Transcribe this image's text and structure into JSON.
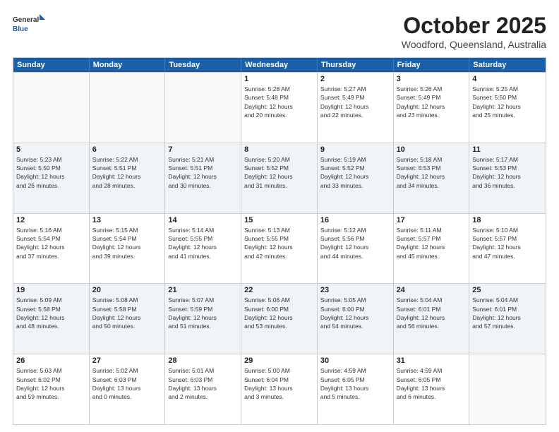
{
  "header": {
    "logo_line1": "General",
    "logo_line2": "Blue",
    "title": "October 2025",
    "location": "Woodford, Queensland, Australia"
  },
  "weekdays": [
    "Sunday",
    "Monday",
    "Tuesday",
    "Wednesday",
    "Thursday",
    "Friday",
    "Saturday"
  ],
  "rows": [
    [
      {
        "date": "",
        "info": ""
      },
      {
        "date": "",
        "info": ""
      },
      {
        "date": "",
        "info": ""
      },
      {
        "date": "1",
        "info": "Sunrise: 5:28 AM\nSunset: 5:48 PM\nDaylight: 12 hours\nand 20 minutes."
      },
      {
        "date": "2",
        "info": "Sunrise: 5:27 AM\nSunset: 5:49 PM\nDaylight: 12 hours\nand 22 minutes."
      },
      {
        "date": "3",
        "info": "Sunrise: 5:26 AM\nSunset: 5:49 PM\nDaylight: 12 hours\nand 23 minutes."
      },
      {
        "date": "4",
        "info": "Sunrise: 5:25 AM\nSunset: 5:50 PM\nDaylight: 12 hours\nand 25 minutes."
      }
    ],
    [
      {
        "date": "5",
        "info": "Sunrise: 5:23 AM\nSunset: 5:50 PM\nDaylight: 12 hours\nand 26 minutes."
      },
      {
        "date": "6",
        "info": "Sunrise: 5:22 AM\nSunset: 5:51 PM\nDaylight: 12 hours\nand 28 minutes."
      },
      {
        "date": "7",
        "info": "Sunrise: 5:21 AM\nSunset: 5:51 PM\nDaylight: 12 hours\nand 30 minutes."
      },
      {
        "date": "8",
        "info": "Sunrise: 5:20 AM\nSunset: 5:52 PM\nDaylight: 12 hours\nand 31 minutes."
      },
      {
        "date": "9",
        "info": "Sunrise: 5:19 AM\nSunset: 5:52 PM\nDaylight: 12 hours\nand 33 minutes."
      },
      {
        "date": "10",
        "info": "Sunrise: 5:18 AM\nSunset: 5:53 PM\nDaylight: 12 hours\nand 34 minutes."
      },
      {
        "date": "11",
        "info": "Sunrise: 5:17 AM\nSunset: 5:53 PM\nDaylight: 12 hours\nand 36 minutes."
      }
    ],
    [
      {
        "date": "12",
        "info": "Sunrise: 5:16 AM\nSunset: 5:54 PM\nDaylight: 12 hours\nand 37 minutes."
      },
      {
        "date": "13",
        "info": "Sunrise: 5:15 AM\nSunset: 5:54 PM\nDaylight: 12 hours\nand 39 minutes."
      },
      {
        "date": "14",
        "info": "Sunrise: 5:14 AM\nSunset: 5:55 PM\nDaylight: 12 hours\nand 41 minutes."
      },
      {
        "date": "15",
        "info": "Sunrise: 5:13 AM\nSunset: 5:55 PM\nDaylight: 12 hours\nand 42 minutes."
      },
      {
        "date": "16",
        "info": "Sunrise: 5:12 AM\nSunset: 5:56 PM\nDaylight: 12 hours\nand 44 minutes."
      },
      {
        "date": "17",
        "info": "Sunrise: 5:11 AM\nSunset: 5:57 PM\nDaylight: 12 hours\nand 45 minutes."
      },
      {
        "date": "18",
        "info": "Sunrise: 5:10 AM\nSunset: 5:57 PM\nDaylight: 12 hours\nand 47 minutes."
      }
    ],
    [
      {
        "date": "19",
        "info": "Sunrise: 5:09 AM\nSunset: 5:58 PM\nDaylight: 12 hours\nand 48 minutes."
      },
      {
        "date": "20",
        "info": "Sunrise: 5:08 AM\nSunset: 5:58 PM\nDaylight: 12 hours\nand 50 minutes."
      },
      {
        "date": "21",
        "info": "Sunrise: 5:07 AM\nSunset: 5:59 PM\nDaylight: 12 hours\nand 51 minutes."
      },
      {
        "date": "22",
        "info": "Sunrise: 5:06 AM\nSunset: 6:00 PM\nDaylight: 12 hours\nand 53 minutes."
      },
      {
        "date": "23",
        "info": "Sunrise: 5:05 AM\nSunset: 6:00 PM\nDaylight: 12 hours\nand 54 minutes."
      },
      {
        "date": "24",
        "info": "Sunrise: 5:04 AM\nSunset: 6:01 PM\nDaylight: 12 hours\nand 56 minutes."
      },
      {
        "date": "25",
        "info": "Sunrise: 5:04 AM\nSunset: 6:01 PM\nDaylight: 12 hours\nand 57 minutes."
      }
    ],
    [
      {
        "date": "26",
        "info": "Sunrise: 5:03 AM\nSunset: 6:02 PM\nDaylight: 12 hours\nand 59 minutes."
      },
      {
        "date": "27",
        "info": "Sunrise: 5:02 AM\nSunset: 6:03 PM\nDaylight: 13 hours\nand 0 minutes."
      },
      {
        "date": "28",
        "info": "Sunrise: 5:01 AM\nSunset: 6:03 PM\nDaylight: 13 hours\nand 2 minutes."
      },
      {
        "date": "29",
        "info": "Sunrise: 5:00 AM\nSunset: 6:04 PM\nDaylight: 13 hours\nand 3 minutes."
      },
      {
        "date": "30",
        "info": "Sunrise: 4:59 AM\nSunset: 6:05 PM\nDaylight: 13 hours\nand 5 minutes."
      },
      {
        "date": "31",
        "info": "Sunrise: 4:59 AM\nSunset: 6:05 PM\nDaylight: 13 hours\nand 6 minutes."
      },
      {
        "date": "",
        "info": ""
      }
    ]
  ]
}
